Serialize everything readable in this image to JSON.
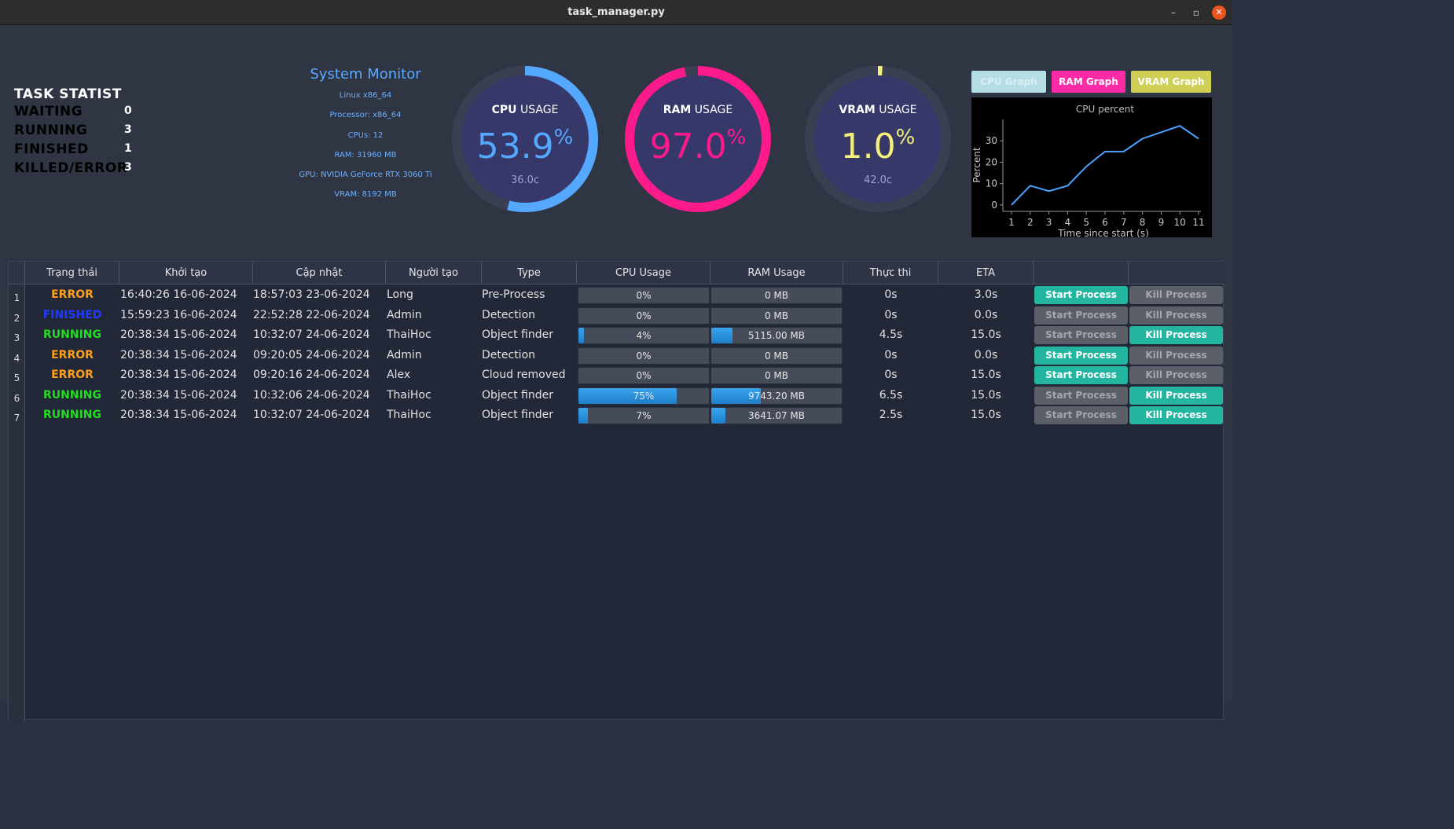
{
  "window": {
    "title": "task_manager.py"
  },
  "stats": {
    "title": "TASK STATIST",
    "items": [
      {
        "label": "WAITING",
        "value": "0",
        "color": "#ffff00"
      },
      {
        "label": "RUNNING",
        "value": "3",
        "color": "#22dd22"
      },
      {
        "label": "FINISHED",
        "value": "1",
        "color": "#1f3bff"
      },
      {
        "label": "KILLED/ERROR",
        "value": "3",
        "color": "#ff1a1a"
      }
    ]
  },
  "system": {
    "title": "System Monitor",
    "info": [
      "Linux x86_64",
      "Processor: x86_64",
      "CPUs: 12",
      "RAM: 31960 MB",
      "GPU: NVIDIA GeForce RTX 3060 Ti",
      "VRAM: 8192 MB"
    ]
  },
  "gauges": [
    {
      "label_bold": "CPU",
      "label_rest": " USAGE",
      "value": "53.9",
      "unit": "%",
      "temp": "36.0c",
      "percent": 53.9,
      "color": "#55a8ff"
    },
    {
      "label_bold": "RAM",
      "label_rest": " USAGE",
      "value": "97.0",
      "unit": "%",
      "temp": "",
      "percent": 97.0,
      "color": "#ff1a8c"
    },
    {
      "label_bold": "VRAM",
      "label_rest": " USAGE",
      "value": "1.0",
      "unit": "%",
      "temp": "42.0c",
      "percent": 1.0,
      "color": "#f5f07a"
    }
  ],
  "graph_buttons": [
    {
      "label": "CPU Graph",
      "bg": "#b4dde6",
      "fg": "#d9eef2"
    },
    {
      "label": "RAM Graph",
      "bg": "#ff2aa8",
      "fg": "#ffffff"
    },
    {
      "label": "VRAM Graph",
      "bg": "#cfcf55",
      "fg": "#ffffff"
    }
  ],
  "graph": {
    "title": "CPU percent",
    "xlabel": "Time since start (s)",
    "ylabel": "Percent"
  },
  "chart_data": {
    "type": "line",
    "title": "CPU percent",
    "xlabel": "Time since start (s)",
    "ylabel": "Percent",
    "x": [
      1,
      2,
      3,
      4,
      5,
      6,
      7,
      8,
      9,
      10,
      11
    ],
    "series": [
      {
        "values": [
          0,
          9,
          6.5,
          9,
          18,
          25,
          25,
          31,
          34,
          37,
          31
        ]
      }
    ],
    "yticks": [
      0,
      10,
      20,
      30
    ],
    "xlim": [
      1,
      11
    ],
    "ylim": [
      -3,
      40
    ],
    "grid": false,
    "color": "#4aa3ff"
  },
  "table": {
    "columns": [
      "Trạng thái",
      "Khởi tạo",
      "Cập nhật",
      "Người tạo",
      "Type",
      "CPU Usage",
      "RAM Usage",
      "Thực thi",
      "ETA",
      "",
      ""
    ],
    "start_label": "Start Process",
    "kill_label": "Kill Process",
    "rows": [
      {
        "num": "1",
        "status": "ERROR",
        "status_color": "#ff9e1a",
        "created": "16:40:26 16-06-2024",
        "updated": "18:57:03 23-06-2024",
        "creator": "Long",
        "type": "Pre-Process",
        "cpu": "0%",
        "cpu_pct": 0,
        "ram": "0 MB",
        "ram_pct": 0,
        "exec": "0s",
        "eta": "3.0s",
        "start_on": true,
        "kill_on": false
      },
      {
        "num": "2",
        "status": "FINISHED",
        "status_color": "#1f3bff",
        "created": "15:59:23 16-06-2024",
        "updated": "22:52:28 22-06-2024",
        "creator": "Admin",
        "type": "Detection",
        "cpu": "0%",
        "cpu_pct": 0,
        "ram": "0 MB",
        "ram_pct": 0,
        "exec": "0s",
        "eta": "0.0s",
        "start_on": false,
        "kill_on": false
      },
      {
        "num": "3",
        "status": "RUNNING",
        "status_color": "#22dd22",
        "created": "20:38:34 15-06-2024",
        "updated": "10:32:07 24-06-2024",
        "creator": "ThaiHoc",
        "type": "Object finder",
        "cpu": "4%",
        "cpu_pct": 4,
        "ram": "5115.00 MB",
        "ram_pct": 16,
        "exec": "4.5s",
        "eta": "15.0s",
        "start_on": false,
        "kill_on": true
      },
      {
        "num": "4",
        "status": "ERROR",
        "status_color": "#ff9e1a",
        "created": "20:38:34 15-06-2024",
        "updated": "09:20:05 24-06-2024",
        "creator": "Admin",
        "type": "Detection",
        "cpu": "0%",
        "cpu_pct": 0,
        "ram": "0 MB",
        "ram_pct": 0,
        "exec": "0s",
        "eta": "0.0s",
        "start_on": true,
        "kill_on": false
      },
      {
        "num": "5",
        "status": "ERROR",
        "status_color": "#ff9e1a",
        "created": "20:38:34 15-06-2024",
        "updated": "09:20:16 24-06-2024",
        "creator": "Alex",
        "type": "Cloud removed",
        "cpu": "0%",
        "cpu_pct": 0,
        "ram": "0 MB",
        "ram_pct": 0,
        "exec": "0s",
        "eta": "15.0s",
        "start_on": true,
        "kill_on": false
      },
      {
        "num": "6",
        "status": "RUNNING",
        "status_color": "#22dd22",
        "created": "20:38:34 15-06-2024",
        "updated": "10:32:06 24-06-2024",
        "creator": "ThaiHoc",
        "type": "Object finder",
        "cpu": "75%",
        "cpu_pct": 75,
        "ram": "9743.20 MB",
        "ram_pct": 38,
        "exec": "6.5s",
        "eta": "15.0s",
        "start_on": false,
        "kill_on": true
      },
      {
        "num": "7",
        "status": "RUNNING",
        "status_color": "#22dd22",
        "created": "20:38:34 15-06-2024",
        "updated": "10:32:07 24-06-2024",
        "creator": "ThaiHoc",
        "type": "Object finder",
        "cpu": "7%",
        "cpu_pct": 7,
        "ram": "3641.07 MB",
        "ram_pct": 11,
        "exec": "2.5s",
        "eta": "15.0s",
        "start_on": false,
        "kill_on": true
      }
    ]
  }
}
